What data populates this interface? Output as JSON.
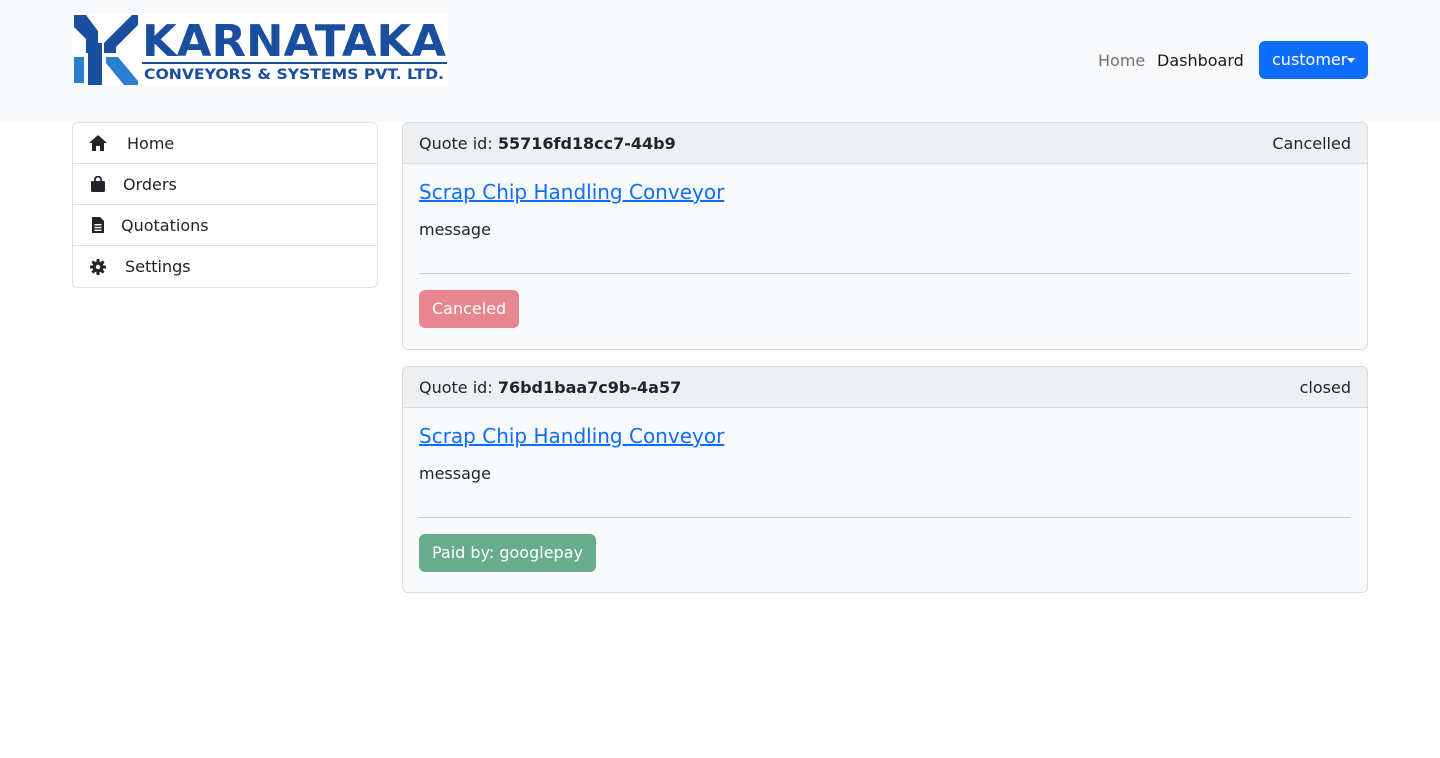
{
  "brand": {
    "logo_main": "KARNATAKA",
    "logo_sub": "CONVEYORS & SYSTEMS PVT. LTD.",
    "color": "#1a4fa0"
  },
  "nav": {
    "home": "Home",
    "dashboard": "Dashboard",
    "user_dropdown": "customer"
  },
  "sidebar": {
    "items": [
      {
        "label": "Home",
        "icon": "home-icon"
      },
      {
        "label": "Orders",
        "icon": "shopping-bag-icon"
      },
      {
        "label": "Quotations",
        "icon": "document-icon"
      },
      {
        "label": "Settings",
        "icon": "gear-icon"
      }
    ]
  },
  "quotes": [
    {
      "id_label": "Quote id:",
      "id": "55716fd18cc7-44b9",
      "status": "Cancelled",
      "title": "Scrap Chip Handling Conveyor",
      "message": "message",
      "action": "Canceled",
      "action_color": "#e8868f"
    },
    {
      "id_label": "Quote id:",
      "id": "76bd1baa7c9b-4a57",
      "status": "closed",
      "title": "Scrap Chip Handling Conveyor",
      "message": "message",
      "action": "Paid by: googlepay",
      "action_color": "#67ac8c"
    }
  ]
}
